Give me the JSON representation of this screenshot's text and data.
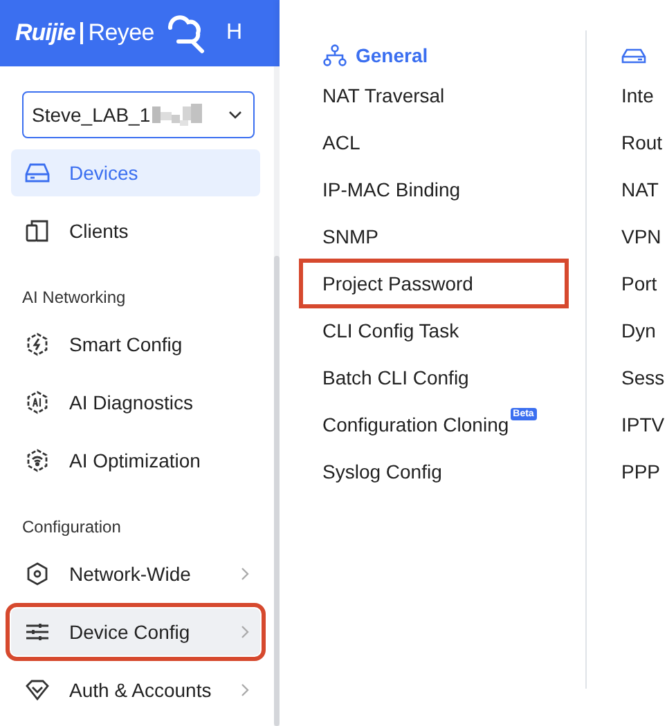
{
  "header": {
    "brand": "Ruijie",
    "product": "Reyee",
    "next_tab": "H"
  },
  "project_selector": {
    "value": "Steve_LAB_1"
  },
  "sidebar": {
    "items": [
      {
        "kind": "item",
        "label": "Devices",
        "selected": true,
        "submenu": false,
        "annotated": false
      },
      {
        "kind": "item",
        "label": "Clients",
        "selected": false,
        "submenu": false,
        "annotated": false
      },
      {
        "kind": "section",
        "label": "AI Networking"
      },
      {
        "kind": "item",
        "label": "Smart Config",
        "selected": false,
        "submenu": false,
        "annotated": false
      },
      {
        "kind": "item",
        "label": "AI Diagnostics",
        "selected": false,
        "submenu": false,
        "annotated": false
      },
      {
        "kind": "item",
        "label": "AI Optimization",
        "selected": false,
        "submenu": false,
        "annotated": false
      },
      {
        "kind": "section",
        "label": "Configuration"
      },
      {
        "kind": "item",
        "label": "Network-Wide",
        "selected": false,
        "submenu": true,
        "annotated": false
      },
      {
        "kind": "item",
        "label": "Device Config",
        "selected": false,
        "hovered": true,
        "submenu": true,
        "annotated": true
      },
      {
        "kind": "item",
        "label": "Auth & Accounts",
        "selected": false,
        "submenu": true,
        "annotated": false
      }
    ]
  },
  "menu": {
    "columns": [
      {
        "title": "General",
        "items": [
          {
            "label": "NAT Traversal",
            "annotated": false
          },
          {
            "label": "ACL",
            "annotated": false
          },
          {
            "label": "IP-MAC Binding",
            "annotated": false
          },
          {
            "label": "SNMP",
            "annotated": false
          },
          {
            "label": "Project Password",
            "annotated": true
          },
          {
            "label": "CLI Config Task",
            "annotated": false
          },
          {
            "label": "Batch CLI Config",
            "annotated": false
          },
          {
            "label": "Configuration Cloning",
            "badge": "Beta",
            "annotated": false
          },
          {
            "label": "Syslog Config",
            "annotated": false
          }
        ]
      },
      {
        "items": [
          {
            "label": "Inte",
            "annotated": false
          },
          {
            "label": "Rout",
            "annotated": false
          },
          {
            "label": "NAT",
            "annotated": false
          },
          {
            "label": "VPN",
            "annotated": false
          },
          {
            "label": "Port",
            "annotated": false
          },
          {
            "label": "Dyn",
            "annotated": false
          },
          {
            "label": "Sess",
            "annotated": false
          },
          {
            "label": "IPTV",
            "annotated": false
          },
          {
            "label": "PPP",
            "annotated": false
          }
        ]
      }
    ]
  }
}
